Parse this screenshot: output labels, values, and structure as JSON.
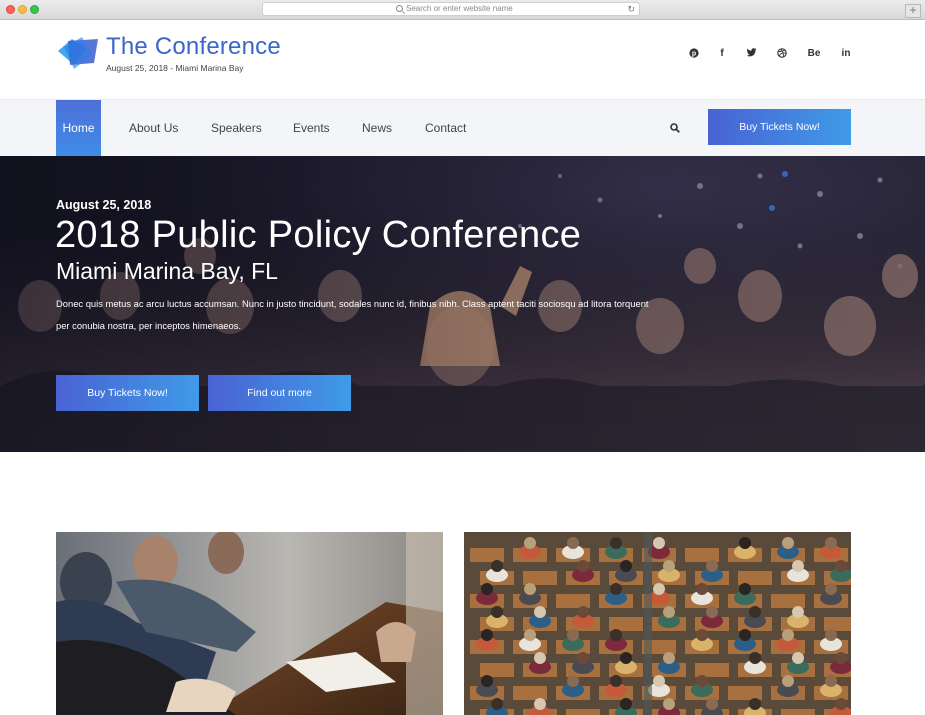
{
  "browser": {
    "url_placeholder": "Search or enter website name",
    "reload_icon": "reload-icon",
    "new_tab_label": "+"
  },
  "brand": {
    "title": "The Conference",
    "subtitle": "August 25, 2018 - Miami Marina Bay",
    "accent": "#3a66c9"
  },
  "social": [
    {
      "icon": "pinterest-icon",
      "label": "p"
    },
    {
      "icon": "facebook-icon",
      "label": "f"
    },
    {
      "icon": "twitter-icon",
      "label": "t"
    },
    {
      "icon": "dribbble-icon",
      "label": "d"
    },
    {
      "icon": "behance-icon",
      "label": "Be"
    },
    {
      "icon": "linkedin-icon",
      "label": "in"
    }
  ],
  "nav": {
    "items": [
      "Home",
      "About Us",
      "Speakers",
      "Events",
      "News",
      "Contact"
    ],
    "active": "Home",
    "cta": "Buy Tickets Now!"
  },
  "hero": {
    "date": "August 25, 2018",
    "title": "2018 Public Policy Conference",
    "location": "Miami Marina Bay, FL",
    "description": "Donec quis metus ac arcu luctus accumsan. Nunc in justo tincidunt, sodales nunc id, finibus nibh. Class aptent taciti sociosqu ad litora torquent per conubia nostra, per inceptos himenaeos.",
    "primary_button": "Buy Tickets Now!",
    "secondary_button": "Find out more"
  },
  "colors": {
    "button_gradient_start": "#4a62d3",
    "button_gradient_end": "#3f9be8",
    "nav_background": "#f3f5f8"
  }
}
